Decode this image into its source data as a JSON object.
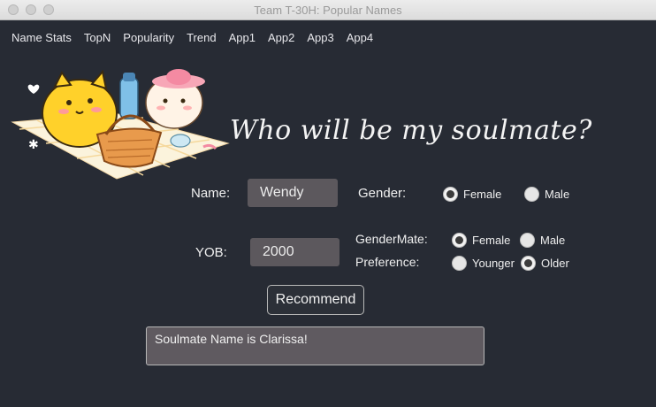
{
  "window": {
    "title": "Team T-30H: Popular Names"
  },
  "menu": [
    "Name Stats",
    "TopN",
    "Popularity",
    "Trend",
    "App1",
    "App2",
    "App3",
    "App4"
  ],
  "headline": "Who will be my soulmate?",
  "illustration": "two cartoon cats having a picnic on a checkered blanket",
  "form": {
    "name_label": "Name:",
    "name_value": "Wendy",
    "gender_label": "Gender:",
    "gender_options": [
      "Female",
      "Male"
    ],
    "gender_selected": "Female",
    "yob_label": "YOB:",
    "yob_value": "2000",
    "gendermate_label": "GenderMate:",
    "gendermate_options": [
      "Female",
      "Male"
    ],
    "gendermate_selected": "Female",
    "preference_label": "Preference:",
    "preference_options": [
      "Younger",
      "Older"
    ],
    "preference_selected": "Older",
    "recommend_label": "Recommend"
  },
  "result": {
    "text": "Soulmate Name is Clarissa!"
  },
  "colors": {
    "background": "#272b34",
    "field": "#5c585d",
    "text": "#f0f0f0"
  }
}
